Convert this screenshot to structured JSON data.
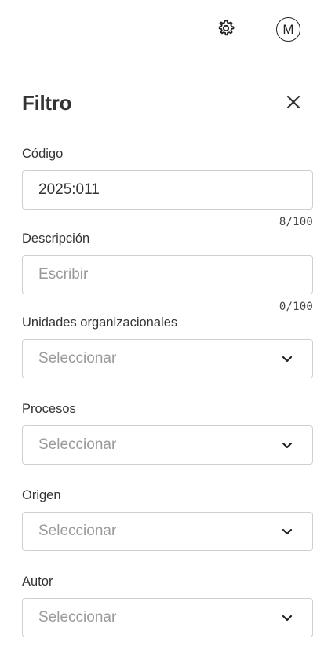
{
  "header": {
    "settings_icon": "gear-icon",
    "avatar_initial": "M"
  },
  "panel": {
    "title": "Filtro",
    "close_icon": "close-icon"
  },
  "fields": {
    "codigo": {
      "label": "Código",
      "value": "2025:011",
      "counter": "8/100"
    },
    "descripcion": {
      "label": "Descripción",
      "placeholder": "Escribir",
      "counter": "0/100"
    },
    "unidades": {
      "label": "Unidades organizacionales",
      "selected": "Seleccionar"
    },
    "procesos": {
      "label": "Procesos",
      "selected": "Seleccionar"
    },
    "origen": {
      "label": "Origen",
      "selected": "Seleccionar"
    },
    "autor": {
      "label": "Autor",
      "selected": "Seleccionar"
    }
  },
  "colors": {
    "border": "#cfcfcf",
    "placeholder": "#9a9a9a",
    "text": "#333333"
  }
}
